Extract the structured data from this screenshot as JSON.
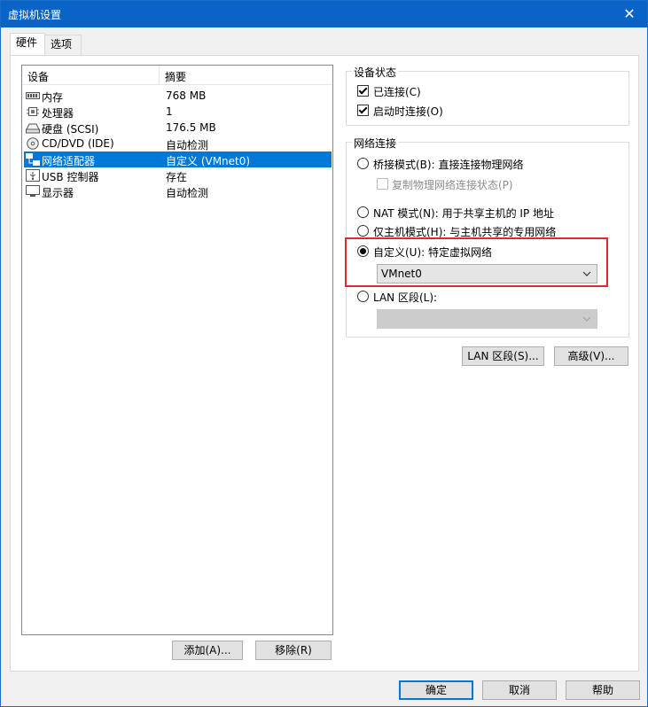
{
  "window": {
    "title": "虚拟机设置",
    "close_glyph": "✕"
  },
  "tabs": [
    {
      "label": "硬件"
    },
    {
      "label": "选项"
    }
  ],
  "device_list": {
    "columns": {
      "device": "设备",
      "summary": "摘要"
    },
    "rows": [
      {
        "name": "内存",
        "summary": "768 MB",
        "icon": "memory-icon"
      },
      {
        "name": "处理器",
        "summary": "1",
        "icon": "cpu-icon"
      },
      {
        "name": "硬盘 (SCSI)",
        "summary": "176.5 MB",
        "icon": "hard-disk-icon"
      },
      {
        "name": "CD/DVD (IDE)",
        "summary": "自动检测",
        "icon": "cd-dvd-icon"
      },
      {
        "name": "网络适配器",
        "summary": "自定义 (VMnet0)",
        "icon": "network-adapter-icon",
        "selected": true
      },
      {
        "name": "USB 控制器",
        "summary": "存在",
        "icon": "usb-icon"
      },
      {
        "name": "显示器",
        "summary": "自动检测",
        "icon": "monitor-icon"
      }
    ]
  },
  "list_buttons": {
    "add": "添加(A)...",
    "remove": "移除(R)"
  },
  "device_status": {
    "legend": "设备状态",
    "connected": "已连接(C)",
    "connect_at_power_on": "启动时连接(O)"
  },
  "network": {
    "legend": "网络连接",
    "bridged": "桥接模式(B): 直接连接物理网络",
    "replicate": "复制物理网络连接状态(P)",
    "nat": "NAT 模式(N): 用于共享主机的 IP 地址",
    "host_only": "仅主机模式(H): 与主机共享的专用网络",
    "custom": "自定义(U): 特定虚拟网络",
    "custom_value": "VMnet0",
    "lan_segment": "LAN 区段(L):",
    "lan_segment_value": ""
  },
  "network_buttons": {
    "lan_segments": "LAN 区段(S)...",
    "advanced": "高级(V)..."
  },
  "dialog_buttons": {
    "ok": "确定",
    "cancel": "取消",
    "help": "帮助"
  },
  "colors": {
    "titlebar": "#0a64c8",
    "selection": "#0078d7",
    "highlight": "#e0262e"
  }
}
